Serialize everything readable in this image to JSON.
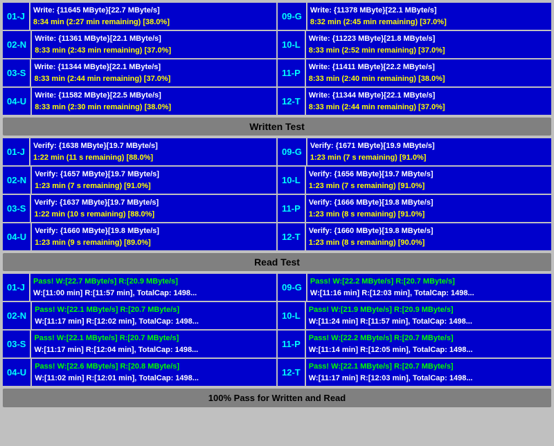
{
  "sections": {
    "write": {
      "rows": [
        {
          "left": {
            "id": "01-J",
            "line1": "Write: {11645 MByte}[22.7 MByte/s]",
            "line2": "8:34 min (2:27 min remaining)  [38.0%]"
          },
          "right": {
            "id": "09-G",
            "line1": "Write: {11378 MByte}[22.1 MByte/s]",
            "line2": "8:32 min (2:45 min remaining)  [37.0%]"
          }
        },
        {
          "left": {
            "id": "02-N",
            "line1": "Write: {11361 MByte}[22.1 MByte/s]",
            "line2": "8:33 min (2:43 min remaining)  [37.0%]"
          },
          "right": {
            "id": "10-L",
            "line1": "Write: {11223 MByte}[21.8 MByte/s]",
            "line2": "8:33 min (2:52 min remaining)  [37.0%]"
          }
        },
        {
          "left": {
            "id": "03-S",
            "line1": "Write: {11344 MByte}[22.1 MByte/s]",
            "line2": "8:33 min (2:44 min remaining)  [37.0%]"
          },
          "right": {
            "id": "11-P",
            "line1": "Write: {11411 MByte}[22.2 MByte/s]",
            "line2": "8:33 min (2:40 min remaining)  [38.0%]"
          }
        },
        {
          "left": {
            "id": "04-U",
            "line1": "Write: {11582 MByte}[22.5 MByte/s]",
            "line2": "8:33 min (2:30 min remaining)  [38.0%]"
          },
          "right": {
            "id": "12-T",
            "line1": "Write: {11344 MByte}[22.1 MByte/s]",
            "line2": "8:33 min (2:44 min remaining)  [37.0%]"
          }
        }
      ],
      "header": "Written Test"
    },
    "verify": {
      "rows": [
        {
          "left": {
            "id": "01-J",
            "line1": "Verify: {1638 MByte}[19.7 MByte/s]",
            "line2": "1:22 min (11 s remaining)   [88.0%]"
          },
          "right": {
            "id": "09-G",
            "line1": "Verify: {1671 MByte}[19.9 MByte/s]",
            "line2": "1:23 min (7 s remaining)   [91.0%]"
          }
        },
        {
          "left": {
            "id": "02-N",
            "line1": "Verify: {1657 MByte}[19.7 MByte/s]",
            "line2": "1:23 min (7 s remaining)   [91.0%]"
          },
          "right": {
            "id": "10-L",
            "line1": "Verify: {1656 MByte}[19.7 MByte/s]",
            "line2": "1:23 min (7 s remaining)   [91.0%]"
          }
        },
        {
          "left": {
            "id": "03-S",
            "line1": "Verify: {1637 MByte}[19.7 MByte/s]",
            "line2": "1:22 min (10 s remaining)   [88.0%]"
          },
          "right": {
            "id": "11-P",
            "line1": "Verify: {1666 MByte}[19.8 MByte/s]",
            "line2": "1:23 min (8 s remaining)   [91.0%]"
          }
        },
        {
          "left": {
            "id": "04-U",
            "line1": "Verify: {1660 MByte}[19.8 MByte/s]",
            "line2": "1:23 min (9 s remaining)   [89.0%]"
          },
          "right": {
            "id": "12-T",
            "line1": "Verify: {1660 MByte}[19.8 MByte/s]",
            "line2": "1:23 min (8 s remaining)   [90.0%]"
          }
        }
      ],
      "header": "Read Test"
    },
    "pass": {
      "rows": [
        {
          "left": {
            "id": "01-J",
            "line1": "Pass! W:[22.7 MByte/s] R:[20.9 MByte/s]",
            "line2": "W:[11:00 min] R:[11:57 min], TotalCap: 1498..."
          },
          "right": {
            "id": "09-G",
            "line1": "Pass! W:[22.2 MByte/s] R:[20.7 MByte/s]",
            "line2": "W:[11:16 min] R:[12:03 min], TotalCap: 1498..."
          }
        },
        {
          "left": {
            "id": "02-N",
            "line1": "Pass! W:[22.1 MByte/s] R:[20.7 MByte/s]",
            "line2": "W:[11:17 min] R:[12:02 min], TotalCap: 1498..."
          },
          "right": {
            "id": "10-L",
            "line1": "Pass! W:[21.9 MByte/s] R:[20.9 MByte/s]",
            "line2": "W:[11:24 min] R:[11:57 min], TotalCap: 1498..."
          }
        },
        {
          "left": {
            "id": "03-S",
            "line1": "Pass! W:[22.1 MByte/s] R:[20.7 MByte/s]",
            "line2": "W:[11:17 min] R:[12:04 min], TotalCap: 1498..."
          },
          "right": {
            "id": "11-P",
            "line1": "Pass! W:[22.2 MByte/s] R:[20.7 MByte/s]",
            "line2": "W:[11:14 min] R:[12:05 min], TotalCap: 1498..."
          }
        },
        {
          "left": {
            "id": "04-U",
            "line1": "Pass! W:[22.6 MByte/s] R:[20.8 MByte/s]",
            "line2": "W:[11:02 min] R:[12:01 min], TotalCap: 1498..."
          },
          "right": {
            "id": "12-T",
            "line1": "Pass! W:[22.1 MByte/s] R:[20.7 MByte/s]",
            "line2": "W:[11:17 min] R:[12:03 min], TotalCap: 1498..."
          }
        }
      ],
      "footer": "100% Pass for Written and Read"
    }
  }
}
